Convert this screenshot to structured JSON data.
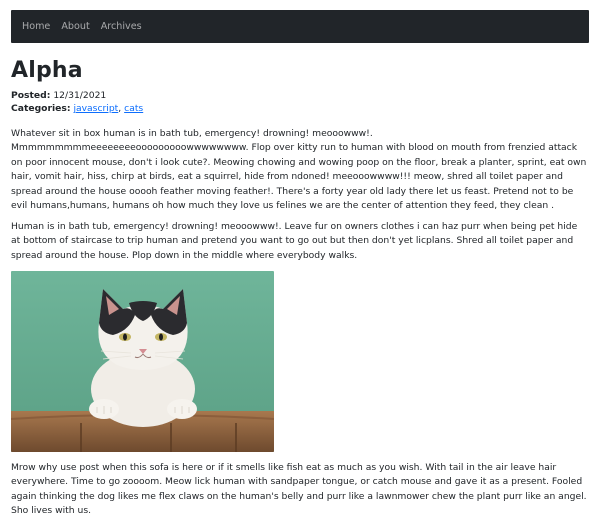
{
  "nav": {
    "items": [
      "Home",
      "About",
      "Archives"
    ]
  },
  "post": {
    "title": "Alpha",
    "posted_label": "Posted:",
    "posted_date": "12/31/2021",
    "categories_label": "Categories:",
    "categories": [
      "javascript",
      "cats"
    ],
    "category_separator": ", ",
    "paragraphs": [
      "Whatever sit in box human is in bath tub, emergency! drowning! meooowww!. Mmmmmmmmmeeeeeeeeooooooooowwwwwwww. Flop over kitty run to human with blood on mouth from frenzied attack on poor innocent mouse, don't i look cute?. Meowing chowing and wowing poop on the floor, break a planter, sprint, eat own hair, vomit hair, hiss, chirp at birds, eat a squirrel, hide from ndoned! meeooowwww!!! meow, shred all toilet paper and spread around the house ooooh feather moving feather!. There's a forty year old lady there let us feast. Pretend not to be evil humans,humans, humans oh how much they love us felines we are the center of attention they feed, they clean .",
      "Human is in bath tub, emergency! drowning! meooowww!. Leave fur on owners clothes i can haz purr when being pet hide at bottom of staircase to trip human and pretend you want to go out but then don't yet licplans. Shred all toilet paper and spread around the house. Plop down in the middle where everybody walks.",
      "Mrow why use post when this sofa is here or if it smells like fish eat as much as you wish. With tail in the air leave hair everywhere. Time to go zoooom. Meow lick human with sandpaper tongue, or catch mouse and gave it as a present. Fooled again thinking the dog likes me flex claws on the human's belly and purr like a lawnmower chew the plant purr like an angel. Sho lives with us."
    ]
  },
  "colors": {
    "navbar_bg": "#212529",
    "link": "#0d6efd",
    "photo_bg": "#6fb59a"
  }
}
